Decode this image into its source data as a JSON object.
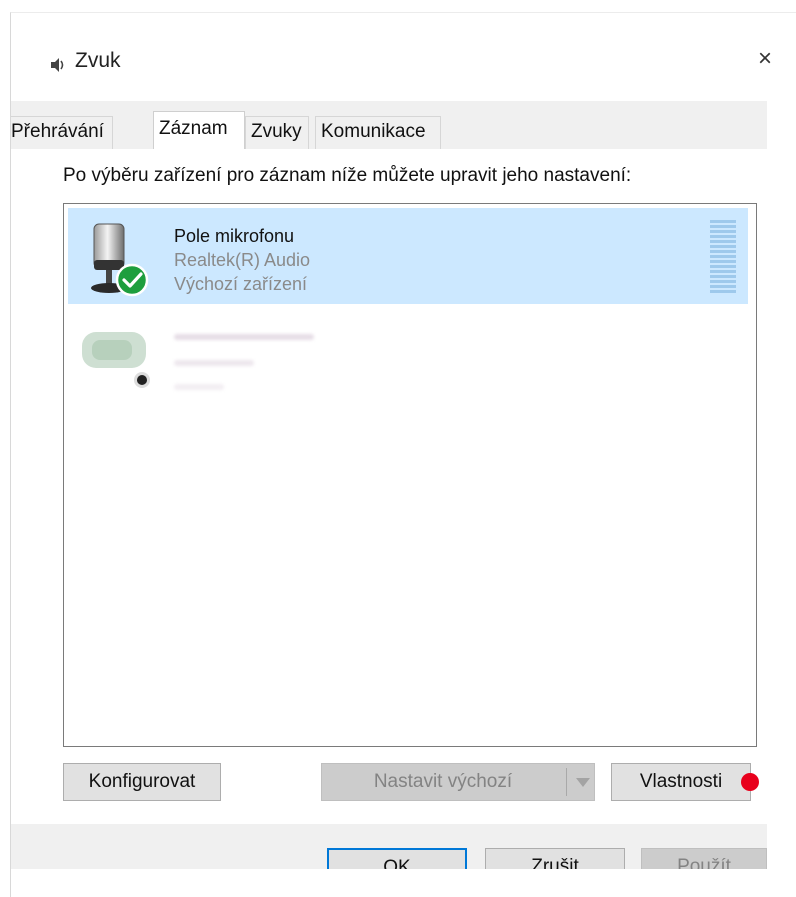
{
  "window": {
    "title": "Zvuk",
    "close_glyph": "×"
  },
  "tabs": [
    {
      "label": "Přehrávání",
      "active": false
    },
    {
      "label": "Záznam",
      "active": true
    },
    {
      "label": "Zvuky",
      "active": false
    },
    {
      "label": "Komunikace",
      "active": false
    }
  ],
  "main": {
    "instruction": "Po výběru zařízení pro záznam níže můžete upravit jeho nastavení:"
  },
  "devices": [
    {
      "name": "Pole mikrofonu",
      "driver": "Realtek(R) Audio",
      "status": "Výchozí zařízení",
      "icon": "microphone-icon",
      "status_icon": "default-check-icon",
      "selected": true
    },
    {
      "icon": "headset-icon",
      "selected": false
    }
  ],
  "buttons": {
    "configure": "Konfigurovat",
    "set_default": "Nastavit výchozí",
    "properties": "Vlastnosti",
    "ok": "OK",
    "cancel": "Zrušit",
    "apply": "Použít"
  },
  "colors": {
    "selection": "#cce8ff",
    "check": "#1e9e3e",
    "annotation_dot": "#e8001c",
    "focus": "#0078d7"
  }
}
